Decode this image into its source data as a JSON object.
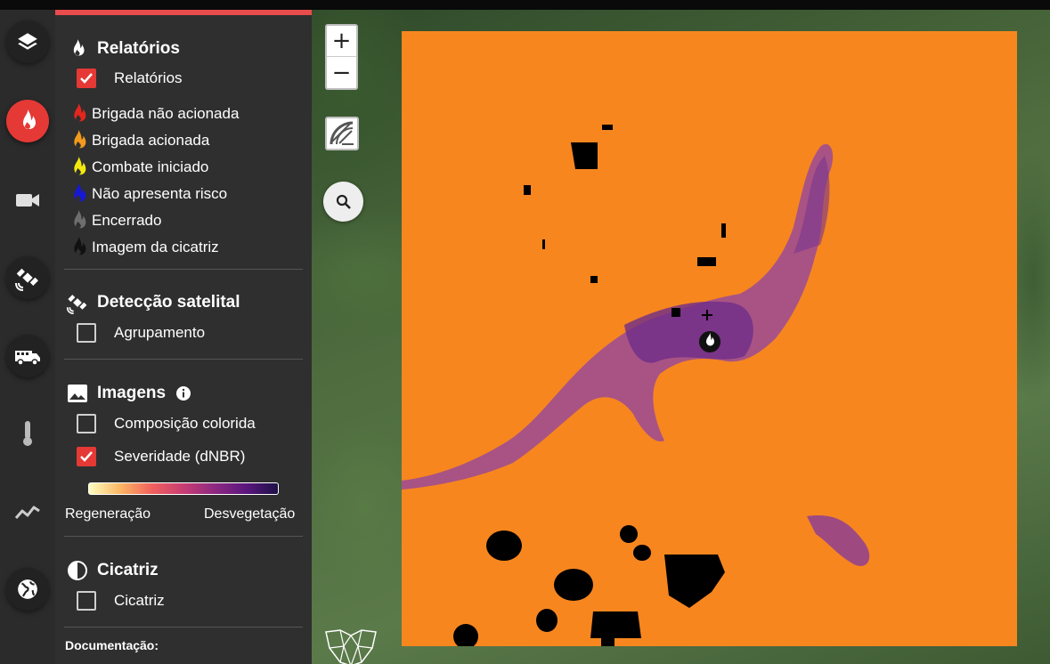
{
  "rail": {
    "items": [
      {
        "icon": "layers-icon",
        "active": false
      },
      {
        "icon": "fire-icon",
        "active": true
      },
      {
        "icon": "camera-icon",
        "active": false
      },
      {
        "icon": "satellite-icon",
        "active": false
      },
      {
        "icon": "fire-truck-icon",
        "active": false
      },
      {
        "icon": "thermometer-icon",
        "active": false
      },
      {
        "icon": "trend-chart-icon",
        "active": false
      },
      {
        "icon": "globe-icon",
        "active": false
      }
    ]
  },
  "panel": {
    "relatorios": {
      "title": "Relatórios",
      "checkbox_label": "Relatórios",
      "checked": true,
      "legend": [
        {
          "label": "Brigada não acionada",
          "color": "#e5261d"
        },
        {
          "label": "Brigada acionada",
          "color": "#f39a1c"
        },
        {
          "label": "Combate iniciado",
          "color": "#f2e80f"
        },
        {
          "label": "Não apresenta risco",
          "color": "#1717d8"
        },
        {
          "label": "Encerrado",
          "color": "#6e6e6e"
        },
        {
          "label": "Imagem da cicatriz",
          "color": "#111111"
        }
      ]
    },
    "deteccao": {
      "title": "Detecção satelital",
      "checkbox_label": "Agrupamento",
      "checked": false
    },
    "imagens": {
      "title": "Imagens",
      "info_icon": "info-icon",
      "options": [
        {
          "label": "Composição colorida",
          "checked": false
        },
        {
          "label": "Severidade (dNBR)",
          "checked": true
        }
      ],
      "gradient_left": "Regeneração",
      "gradient_right": "Desvegetação"
    },
    "cicatriz": {
      "title": "Cicatriz",
      "checkbox_label": "Cicatriz",
      "checked": false
    },
    "documentacao": "Documentação:"
  },
  "map": {
    "zoom_in": "+",
    "zoom_out": "−",
    "raster_base_color": "#f7861f",
    "burn_color": "#8a3a92"
  }
}
